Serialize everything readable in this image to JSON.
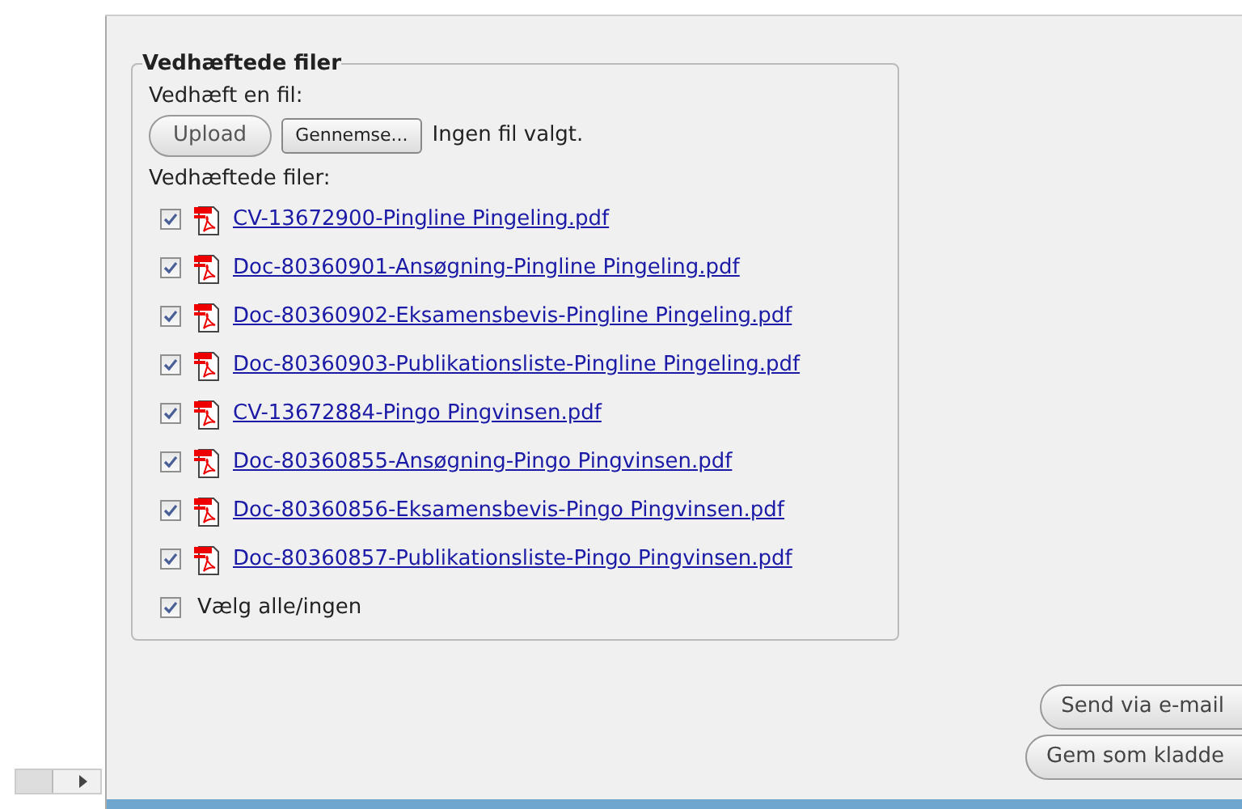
{
  "attachments": {
    "legend": "Vedhæftede filer",
    "attach_label": "Vedhæft en fil:",
    "upload_button": "Upload",
    "browse_button": "Gennemse...",
    "no_file": "Ingen fil valgt.",
    "list_label": "Vedhæftede filer:",
    "files": [
      {
        "name": "CV-13672900-Pingline Pingeling.pdf",
        "checked": true
      },
      {
        "name": "Doc-80360901-Ansøgning-Pingline Pingeling.pdf",
        "checked": true
      },
      {
        "name": "Doc-80360902-Eksamensbevis-Pingline Pingeling.pdf",
        "checked": true
      },
      {
        "name": "Doc-80360903-Publikationsliste-Pingline Pingeling.pdf",
        "checked": true
      },
      {
        "name": "CV-13672884-Pingo Pingvinsen.pdf",
        "checked": true
      },
      {
        "name": "Doc-80360855-Ansøgning-Pingo Pingvinsen.pdf",
        "checked": true
      },
      {
        "name": "Doc-80360856-Eksamensbevis-Pingo Pingvinsen.pdf",
        "checked": true
      },
      {
        "name": "Doc-80360857-Publikationsliste-Pingo Pingvinsen.pdf",
        "checked": true
      }
    ],
    "select_all": {
      "label": "Vælg alle/ingen",
      "checked": true
    }
  },
  "buttons": [
    "Send via e-mail",
    "Gem som kladde"
  ]
}
